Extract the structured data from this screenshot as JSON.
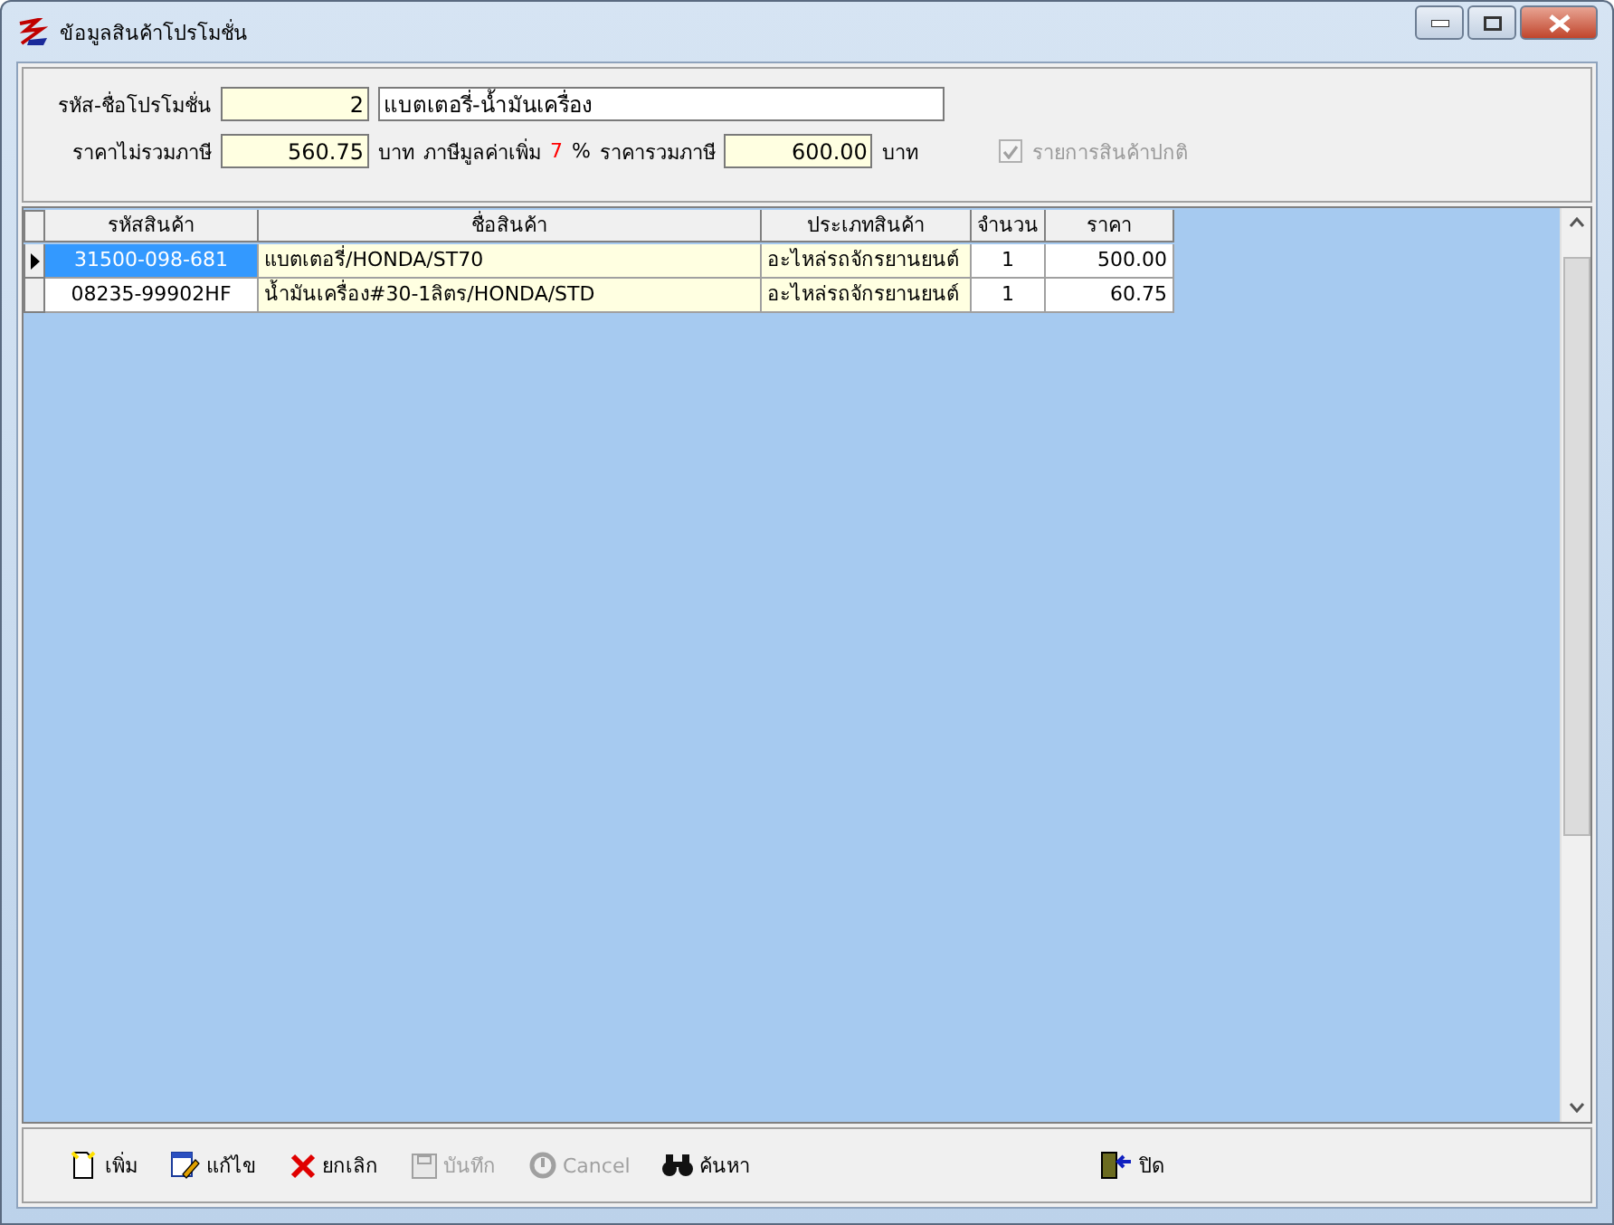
{
  "window": {
    "title": "ข้อมูลสินค้าโปรโมชั่น"
  },
  "form": {
    "promo_label": "รหัส-ชื่อโปรโมชั่น",
    "promo_code": "2",
    "promo_name": "แบตเตอรี่-น้ำมันเครื่อง",
    "price_ex_label": "ราคาไม่รวมภาษี",
    "price_ex": "560.75",
    "baht_1": "บาท",
    "vat_label": "ภาษีมูลค่าเพิ่ม",
    "vat": "7",
    "percent": "%",
    "price_inc_label": "ราคารวมภาษี",
    "price_inc": "600.00",
    "baht_2": "บาท",
    "normal_item": {
      "label": "รายการสินค้าปกติ",
      "checked": true,
      "disabled": true
    }
  },
  "table": {
    "columns": [
      "รหัสสินค้า",
      "ชื่อสินค้า",
      "ประเภทสินค้า",
      "จำนวน",
      "ราคา"
    ],
    "rows": [
      {
        "selected": true,
        "cells": [
          "31500-098-681",
          "แบตเตอรี่/HONDA/ST70",
          "อะไหล่รถจักรยานยนต์",
          "1",
          "500.00"
        ]
      },
      {
        "selected": false,
        "cells": [
          "08235-99902HF",
          "น้ำมันเครื่อง#30-1ลิตร/HONDA/STD",
          "อะไหล่รถจักรยานยนต์",
          "1",
          "60.75"
        ]
      }
    ]
  },
  "toolbar": [
    {
      "kind": "add",
      "label": "เพิ่ม",
      "disabled": false
    },
    {
      "kind": "edit",
      "label": "แก้ไข",
      "disabled": false
    },
    {
      "kind": "delete",
      "label": "ยกเลิก",
      "disabled": false
    },
    {
      "kind": "save",
      "label": "บันทึก",
      "disabled": true
    },
    {
      "kind": "undo",
      "label": "Cancel",
      "disabled": true
    },
    {
      "kind": "search",
      "label": "ค้นหา",
      "disabled": false
    },
    {
      "kind": "close",
      "label": "ปิด",
      "disabled": false
    }
  ]
}
